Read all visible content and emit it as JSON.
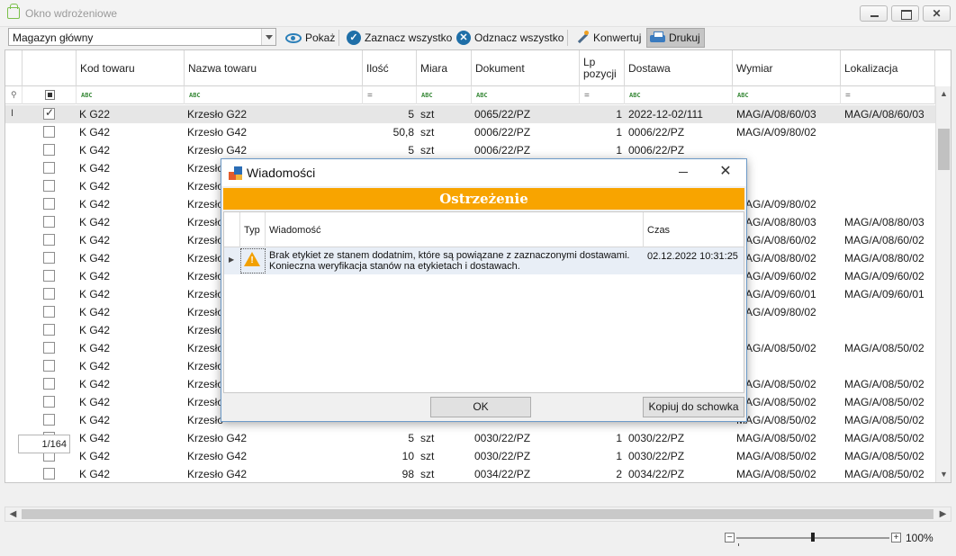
{
  "window": {
    "title": "Okno wdrożeniowe"
  },
  "toolbar": {
    "warehouse": "Magazyn główny",
    "show_label": "Pokaż",
    "select_all_label": "Zaznacz wszystko",
    "deselect_all_label": "Odznacz wszystko",
    "convert_label": "Konwertuj",
    "print_label": "Drukuj"
  },
  "grid": {
    "columns": [
      "Kod towaru",
      "Nazwa towaru",
      "Ilość",
      "Miara",
      "Dokument",
      "Lp pozycji",
      "Dostawa",
      "Wymiar",
      "Lokalizacja"
    ],
    "rows": [
      {
        "checked": true,
        "kod": "K G22",
        "nazwa": "Krzesło G22",
        "ilosc": "5",
        "miara": "szt",
        "dokument": "0065/22/PZ",
        "lp": "1",
        "dostawa": "2022-12-02/111",
        "wymiar": "MAG/A/08/60/03",
        "lokalizacja": "MAG/A/08/60/03"
      },
      {
        "checked": false,
        "kod": "K G42",
        "nazwa": "Krzesło G42",
        "ilosc": "50,8",
        "miara": "szt",
        "dokument": "0006/22/PZ",
        "lp": "1",
        "dostawa": "0006/22/PZ",
        "wymiar": "MAG/A/09/80/02",
        "lokalizacja": ""
      },
      {
        "checked": false,
        "kod": "K G42",
        "nazwa": "Krzesło G42",
        "ilosc": "5",
        "miara": "szt",
        "dokument": "0006/22/PZ",
        "lp": "1",
        "dostawa": "0006/22/PZ",
        "wymiar": "",
        "lokalizacja": ""
      },
      {
        "checked": false,
        "kod": "K G42",
        "nazwa": "Krzesło",
        "ilosc": "",
        "miara": "",
        "dokument": "",
        "lp": "",
        "dostawa": "",
        "wymiar": "",
        "lokalizacja": ""
      },
      {
        "checked": false,
        "kod": "K G42",
        "nazwa": "Krzesło",
        "ilosc": "",
        "miara": "",
        "dokument": "",
        "lp": "",
        "dostawa": "",
        "wymiar": "",
        "lokalizacja": ""
      },
      {
        "checked": false,
        "kod": "K G42",
        "nazwa": "Krzesło",
        "ilosc": "",
        "miara": "",
        "dokument": "",
        "lp": "",
        "dostawa": "",
        "wymiar": "MAG/A/09/80/02",
        "lokalizacja": ""
      },
      {
        "checked": false,
        "kod": "K G42",
        "nazwa": "Krzesło",
        "ilosc": "",
        "miara": "",
        "dokument": "",
        "lp": "",
        "dostawa": "",
        "wymiar": "MAG/A/08/80/03",
        "lokalizacja": "MAG/A/08/80/03"
      },
      {
        "checked": false,
        "kod": "K G42",
        "nazwa": "Krzesło",
        "ilosc": "",
        "miara": "",
        "dokument": "",
        "lp": "",
        "dostawa": "",
        "wymiar": "MAG/A/08/60/02",
        "lokalizacja": "MAG/A/08/60/02"
      },
      {
        "checked": false,
        "kod": "K G42",
        "nazwa": "Krzesło",
        "ilosc": "",
        "miara": "",
        "dokument": "",
        "lp": "",
        "dostawa": "",
        "wymiar": "MAG/A/08/80/02",
        "lokalizacja": "MAG/A/08/80/02"
      },
      {
        "checked": false,
        "kod": "K G42",
        "nazwa": "Krzesło",
        "ilosc": "",
        "miara": "",
        "dokument": "",
        "lp": "",
        "dostawa": "",
        "wymiar": "MAG/A/09/60/02",
        "lokalizacja": "MAG/A/09/60/02"
      },
      {
        "checked": false,
        "kod": "K G42",
        "nazwa": "Krzesło",
        "ilosc": "",
        "miara": "",
        "dokument": "",
        "lp": "",
        "dostawa": "",
        "wymiar": "MAG/A/09/60/01",
        "lokalizacja": "MAG/A/09/60/01"
      },
      {
        "checked": false,
        "kod": "K G42",
        "nazwa": "Krzesło",
        "ilosc": "",
        "miara": "",
        "dokument": "",
        "lp": "",
        "dostawa": "",
        "wymiar": "MAG/A/09/80/02",
        "lokalizacja": ""
      },
      {
        "checked": false,
        "kod": "K G42",
        "nazwa": "Krzesło",
        "ilosc": "",
        "miara": "",
        "dokument": "",
        "lp": "",
        "dostawa": "",
        "wymiar": "",
        "lokalizacja": ""
      },
      {
        "checked": false,
        "kod": "K G42",
        "nazwa": "Krzesło",
        "ilosc": "",
        "miara": "",
        "dokument": "",
        "lp": "",
        "dostawa": "",
        "wymiar": "MAG/A/08/50/02",
        "lokalizacja": "MAG/A/08/50/02"
      },
      {
        "checked": false,
        "kod": "K G42",
        "nazwa": "Krzesło",
        "ilosc": "",
        "miara": "",
        "dokument": "",
        "lp": "",
        "dostawa": "",
        "wymiar": "",
        "lokalizacja": ""
      },
      {
        "checked": false,
        "kod": "K G42",
        "nazwa": "Krzesło",
        "ilosc": "",
        "miara": "",
        "dokument": "",
        "lp": "",
        "dostawa": "",
        "wymiar": "MAG/A/08/50/02",
        "lokalizacja": "MAG/A/08/50/02"
      },
      {
        "checked": false,
        "kod": "K G42",
        "nazwa": "Krzesło",
        "ilosc": "",
        "miara": "",
        "dokument": "",
        "lp": "",
        "dostawa": "",
        "wymiar": "MAG/A/08/50/02",
        "lokalizacja": "MAG/A/08/50/02"
      },
      {
        "checked": false,
        "kod": "K G42",
        "nazwa": "Krzesło",
        "ilosc": "",
        "miara": "",
        "dokument": "",
        "lp": "",
        "dostawa": "",
        "wymiar": "MAG/A/08/50/02",
        "lokalizacja": "MAG/A/08/50/02"
      },
      {
        "checked": false,
        "kod": "K G42",
        "nazwa": "Krzesło G42",
        "ilosc": "5",
        "miara": "szt",
        "dokument": "0030/22/PZ",
        "lp": "1",
        "dostawa": "0030/22/PZ",
        "wymiar": "MAG/A/08/50/02",
        "lokalizacja": "MAG/A/08/50/02"
      },
      {
        "checked": false,
        "kod": "K G42",
        "nazwa": "Krzesło G42",
        "ilosc": "10",
        "miara": "szt",
        "dokument": "0030/22/PZ",
        "lp": "1",
        "dostawa": "0030/22/PZ",
        "wymiar": "MAG/A/08/50/02",
        "lokalizacja": "MAG/A/08/50/02"
      },
      {
        "checked": false,
        "kod": "K G42",
        "nazwa": "Krzesło G42",
        "ilosc": "98",
        "miara": "szt",
        "dokument": "0034/22/PZ",
        "lp": "2",
        "dostawa": "0034/22/PZ",
        "wymiar": "MAG/A/08/50/02",
        "lokalizacja": "MAG/A/08/50/02"
      }
    ],
    "pager": "1/164"
  },
  "zoom": {
    "value": "100%"
  },
  "dialog": {
    "title": "Wiadomości",
    "banner": "Ostrzeżenie",
    "col_typ": "Typ",
    "col_msg": "Wiadomość",
    "col_time": "Czas",
    "message_line1": "Brak etykiet ze stanem dodatnim, które są powiązane z zaznaczonymi dostawami.",
    "message_line2": "Konieczna weryfikacja stanów na etykietach i dostawach.",
    "time": "02.12.2022 10:31:25",
    "ok_label": "OK",
    "copy_label": "Kopiuj do schowka"
  }
}
